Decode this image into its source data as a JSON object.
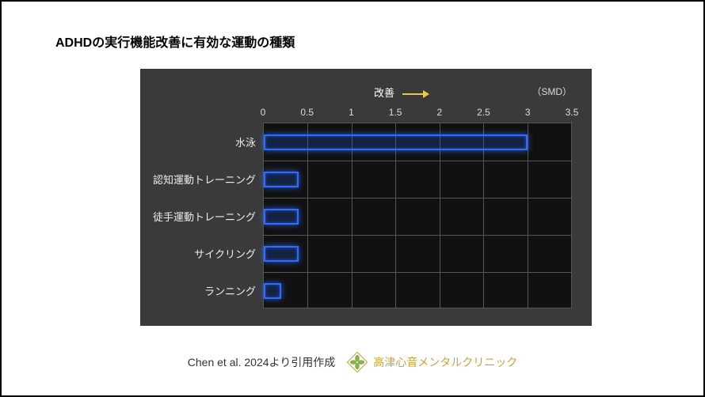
{
  "title": "ADHDの実行機能改善に有効な運動の種類",
  "arrow_label": "改善",
  "unit_label": "（SMD）",
  "citation": "Chen et al. 2024より引用作成",
  "clinic_name": "高津心音メンタルクリニック",
  "ticks": [
    "0",
    "0.5",
    "1",
    "1.5",
    "2",
    "2.5",
    "3",
    "3.5"
  ],
  "chart_data": {
    "type": "bar",
    "orientation": "horizontal",
    "title": "ADHDの実行機能改善に有効な運動の種類",
    "xlabel": "SMD",
    "ylabel": "",
    "xlim": [
      0,
      3.5
    ],
    "annotation": "改善 →",
    "categories": [
      "水泳",
      "認知運動トレーニング",
      "徒手運動トレーニング",
      "サイクリング",
      "ランニング"
    ],
    "values": [
      3.0,
      0.4,
      0.4,
      0.4,
      0.2
    ],
    "grid": true,
    "legend": null,
    "source": "Chen et al. 2024より引用作成"
  }
}
